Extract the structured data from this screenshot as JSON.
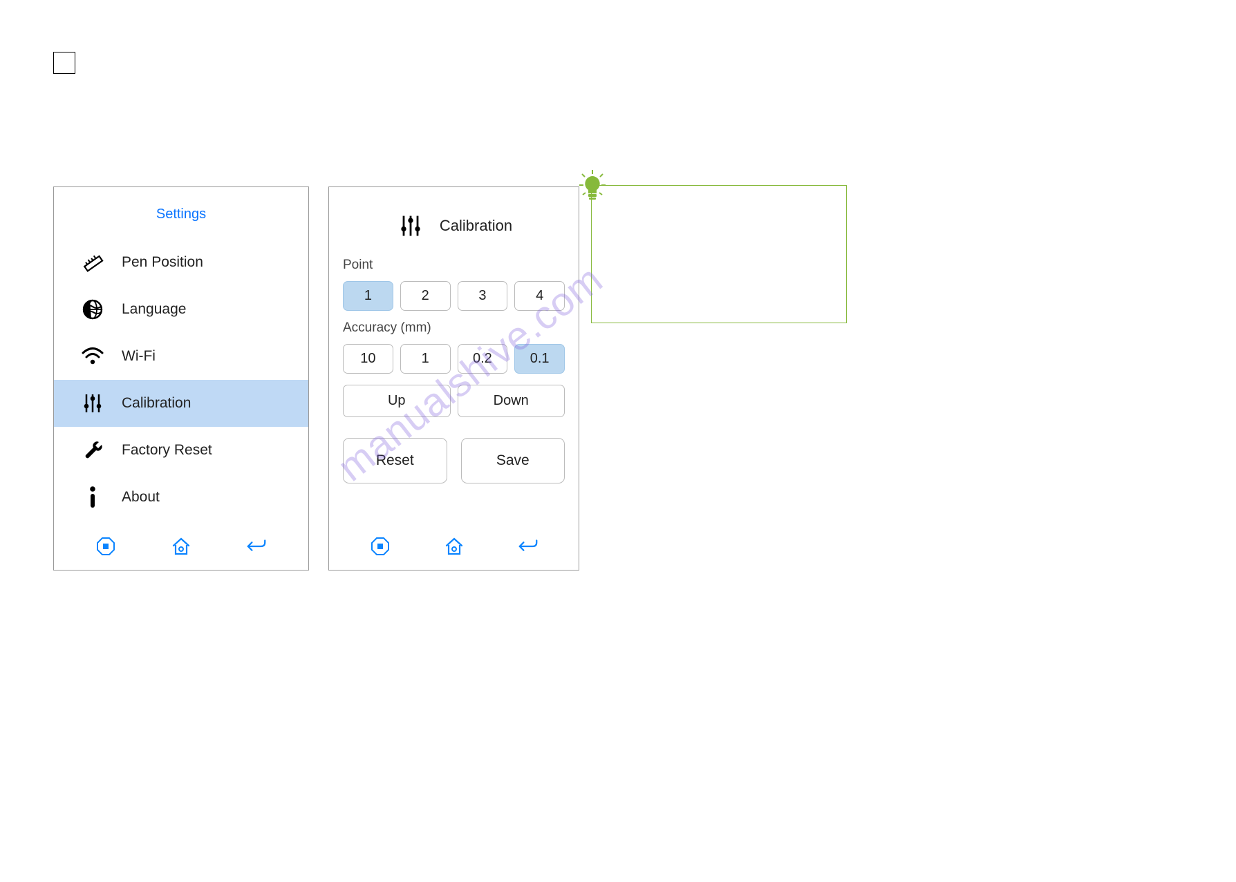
{
  "watermark": "manualshive.com",
  "settings": {
    "title": "Settings",
    "menu": [
      {
        "label": "Pen Position",
        "icon": "ruler-icon"
      },
      {
        "label": "Language",
        "icon": "globe-icon"
      },
      {
        "label": "Wi-Fi",
        "icon": "wifi-icon"
      },
      {
        "label": "Calibration",
        "icon": "sliders-icon",
        "selected": true
      },
      {
        "label": "Factory Reset",
        "icon": "wrench-icon"
      },
      {
        "label": "About",
        "icon": "info-icon"
      }
    ]
  },
  "calibration": {
    "title": "Calibration",
    "point_label": "Point",
    "points": [
      "1",
      "2",
      "3",
      "4"
    ],
    "point_selected": 0,
    "accuracy_label": "Accuracy (mm)",
    "accuracies": [
      "10",
      "1",
      "0.2",
      "0.1"
    ],
    "accuracy_selected": 3,
    "up_label": "Up",
    "down_label": "Down",
    "reset_label": "Reset",
    "save_label": "Save"
  },
  "nav": {
    "stop": "stop",
    "home": "home",
    "back": "back"
  },
  "tip_box_color": "#86b93b",
  "bulb_color": "#86b93b"
}
